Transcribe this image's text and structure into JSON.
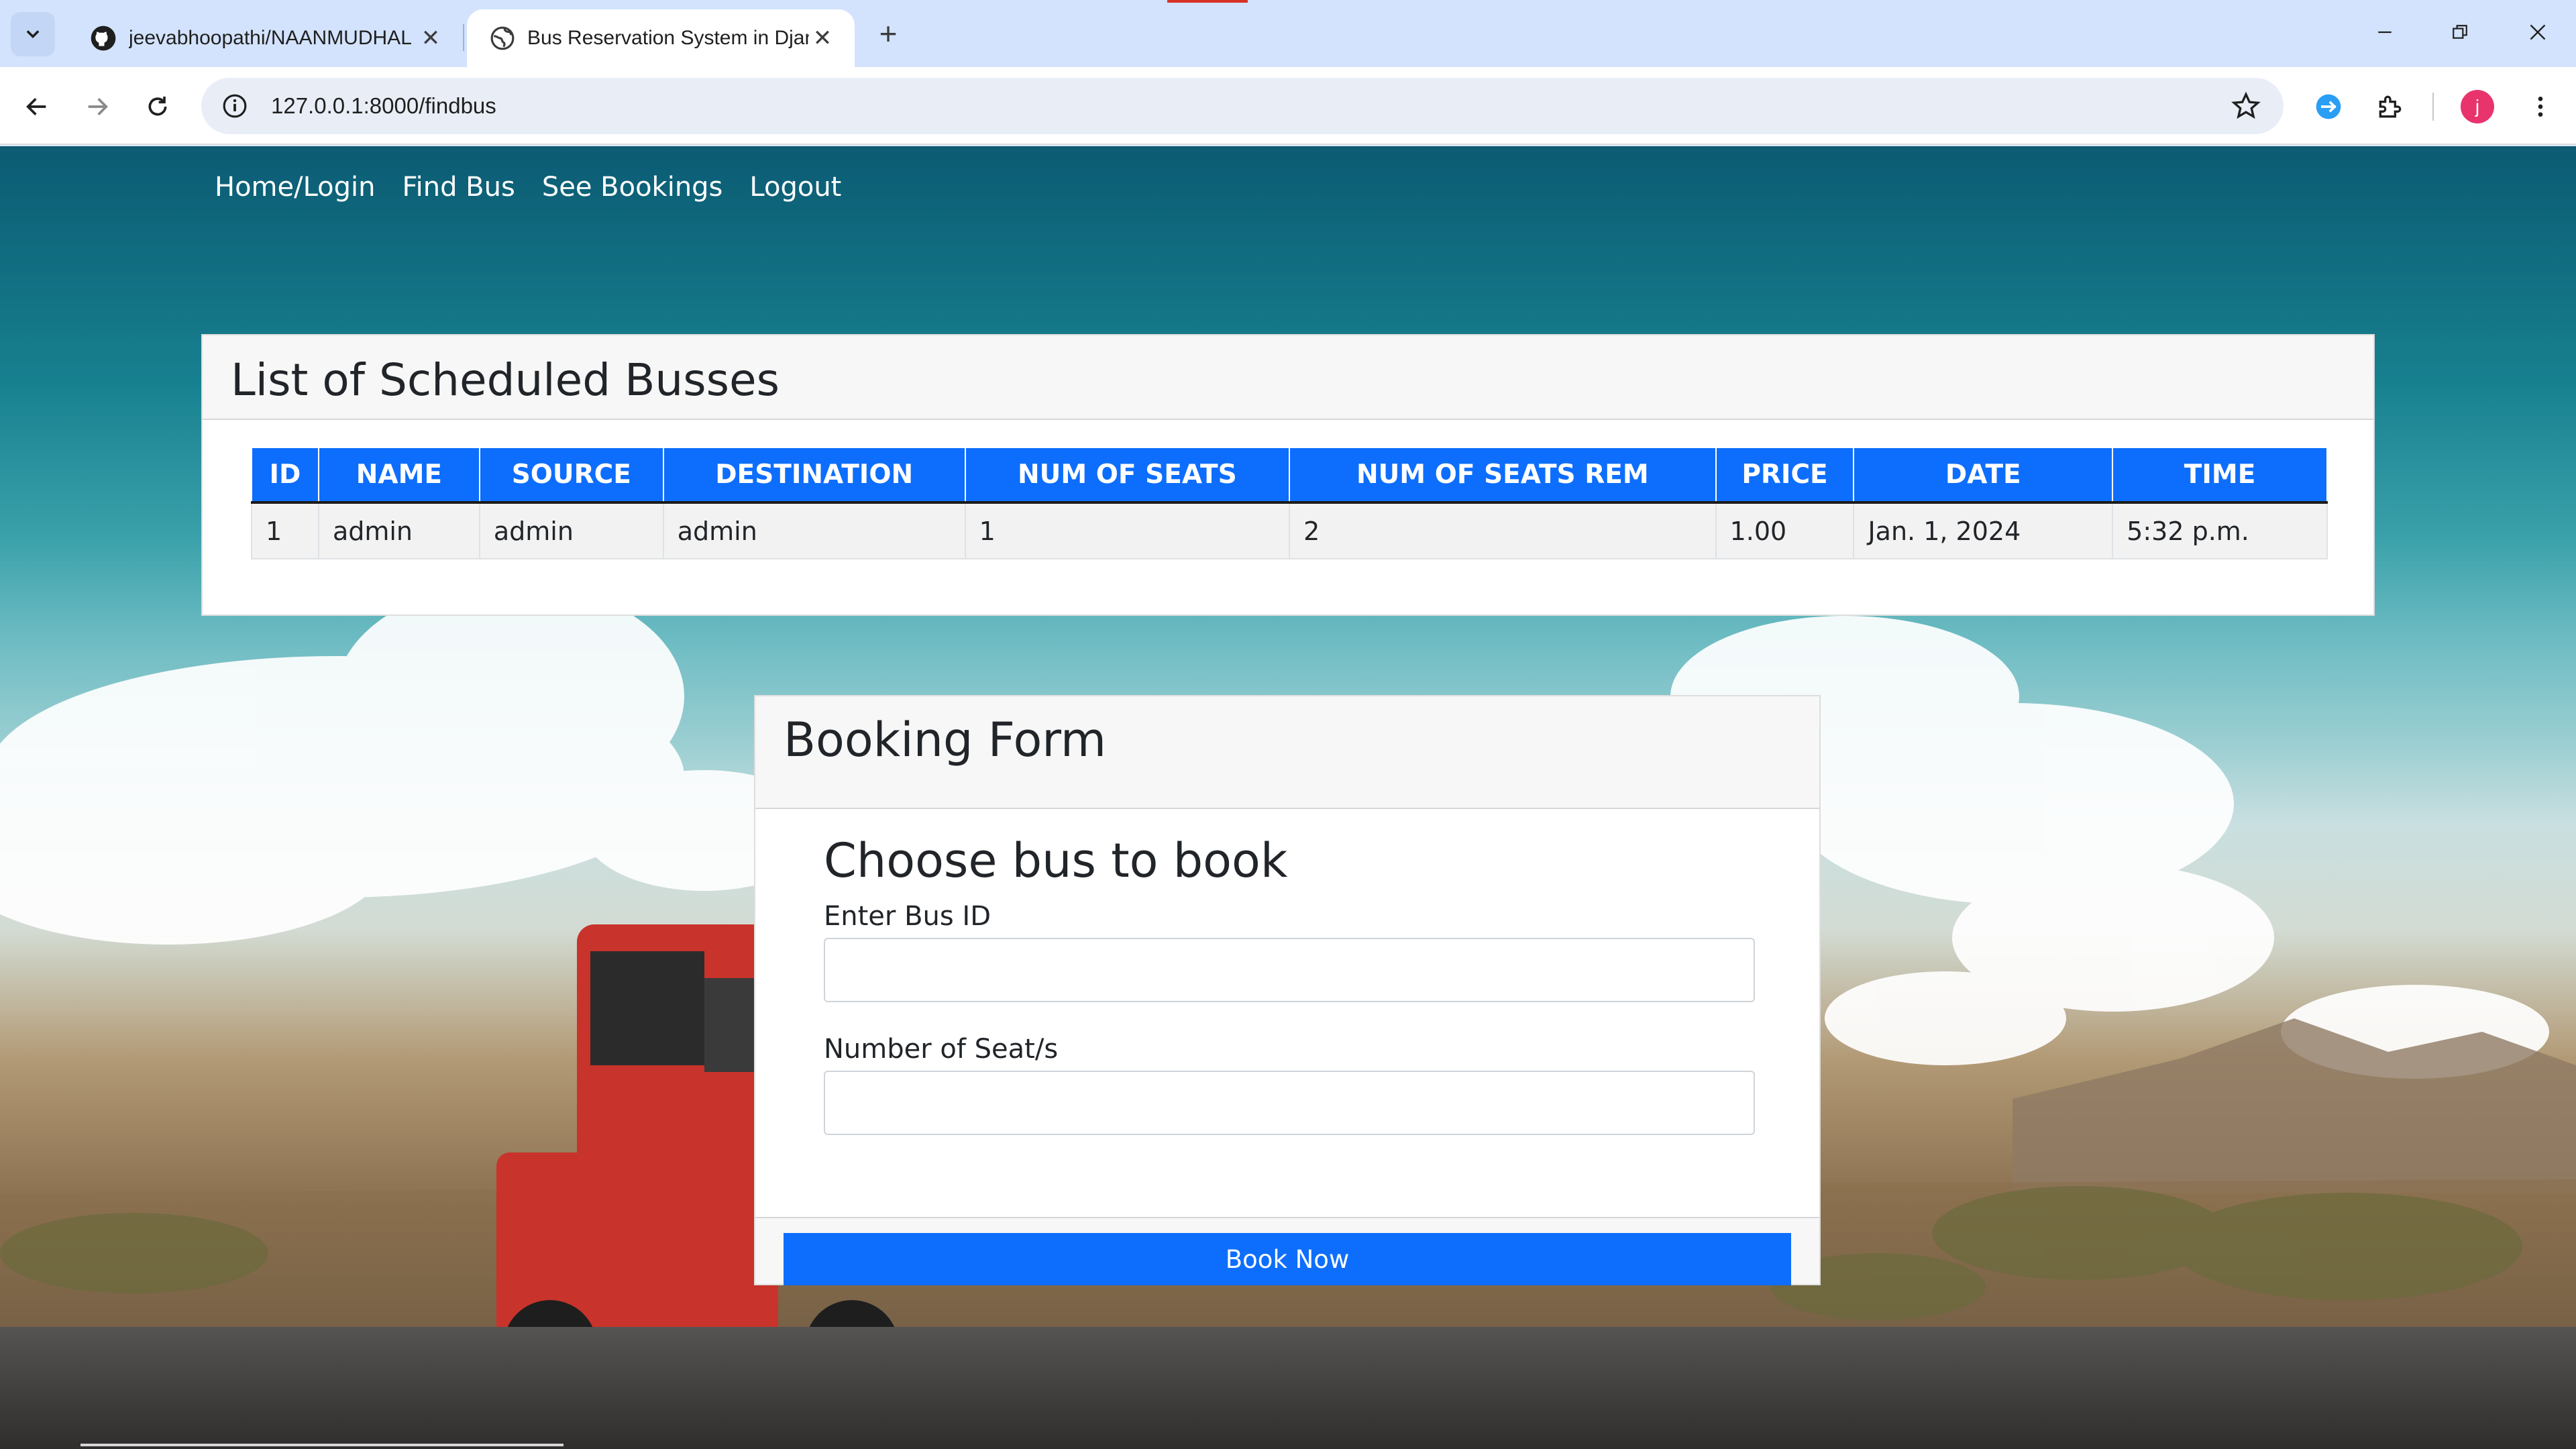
{
  "browser": {
    "tabs": [
      {
        "title": "jeevabhoopathi/NAANMUDHAL",
        "icon": "github-icon",
        "active": false
      },
      {
        "title": "Bus Reservation System in Djan",
        "icon": "globe-icon",
        "active": true
      }
    ],
    "url": "127.0.0.1:8000/findbus",
    "profile_initial": "j"
  },
  "nav": {
    "links": [
      "Home/Login",
      "Find Bus",
      "See Bookings",
      "Logout"
    ]
  },
  "bus_list": {
    "title": "List of Scheduled Busses",
    "columns": [
      "ID",
      "NAME",
      "SOURCE",
      "DESTINATION",
      "NUM OF SEATS",
      "NUM OF SEATS REM",
      "PRICE",
      "DATE",
      "TIME"
    ],
    "rows": [
      [
        "1",
        "admin",
        "admin",
        "admin",
        "1",
        "2",
        "1.00",
        "Jan. 1, 2024",
        "5:32 p.m."
      ]
    ]
  },
  "booking_form": {
    "title": "Booking Form",
    "subtitle": "Choose bus to book",
    "bus_id_label": "Enter Bus ID",
    "seats_label": "Number of Seat/s",
    "submit_label": "Book Now"
  },
  "colors": {
    "primary": "#0d6efd",
    "tabstrip": "#d3e3fd",
    "profile": "#e8336d"
  }
}
